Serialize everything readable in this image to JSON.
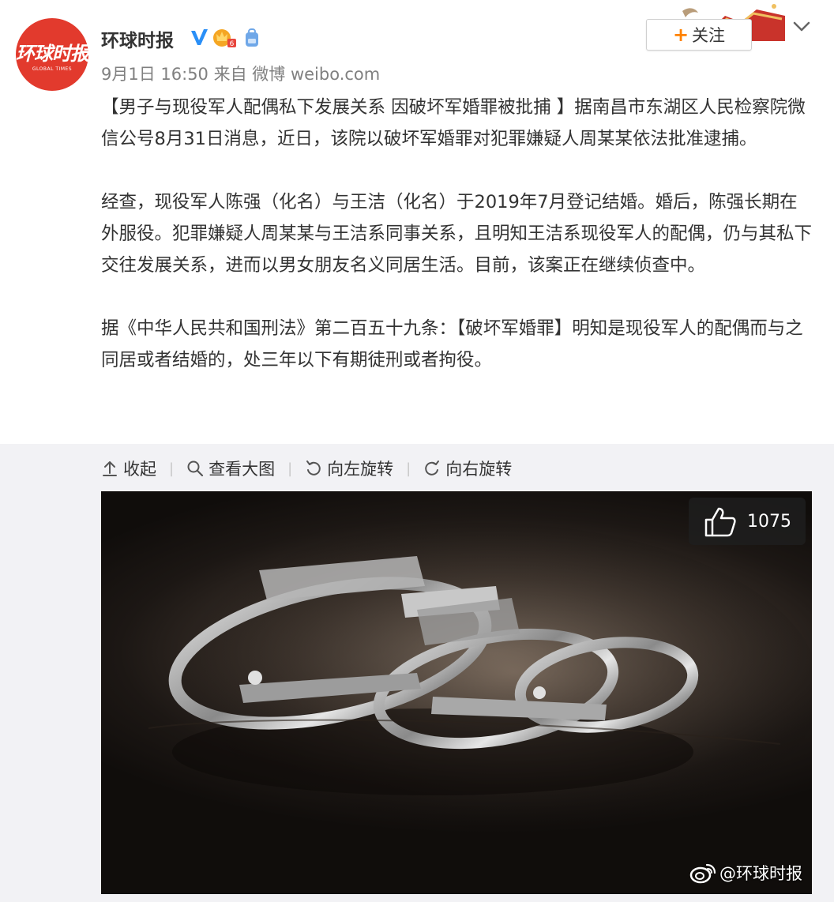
{
  "user": {
    "name": "环球时报",
    "avatar_text": "环球时报",
    "avatar_subtext": "GLOBAL TIMES"
  },
  "meta": {
    "time": "9月1日 16:50",
    "source": "来自 微博 weibo.com"
  },
  "follow": {
    "plus": "+",
    "label": "关注"
  },
  "post": {
    "p1": "【男子与现役军人配偶私下发展关系 因破坏军婚罪被批捕 】据南昌市东湖区人民检察院微信公号8月31日消息，近日，该院以破坏军婚罪对犯罪嫌疑人周某某依法批准逮捕。",
    "p2": "经查，现役军人陈强（化名）与王洁（化名）于2019年7月登记结婚。婚后，陈强长期在外服役。犯罪嫌疑人周某某与王洁系同事关系，且明知王洁系现役军人的配偶，仍与其私下交往发展关系，进而以男女朋友名义同居生活。目前，该案正在继续侦查中。",
    "p3": "据《中华人民共和国刑法》第二百五十九条：【破坏军婚罪】明知是现役军人的配偶而与之同居或者结婚的，处三年以下有期徒刑或者拘役。"
  },
  "toolbar": {
    "collapse": "收起",
    "view_large": "查看大图",
    "rotate_left": "向左旋转",
    "rotate_right": "向右旋转",
    "separator": "|"
  },
  "photo": {
    "likes": "1075",
    "watermark": "@环球时报"
  },
  "colors": {
    "brand_red": "#e23a2d",
    "follow_plus": "#ff8200",
    "meta_gray": "#808080",
    "media_bg": "#f2f2f5"
  }
}
